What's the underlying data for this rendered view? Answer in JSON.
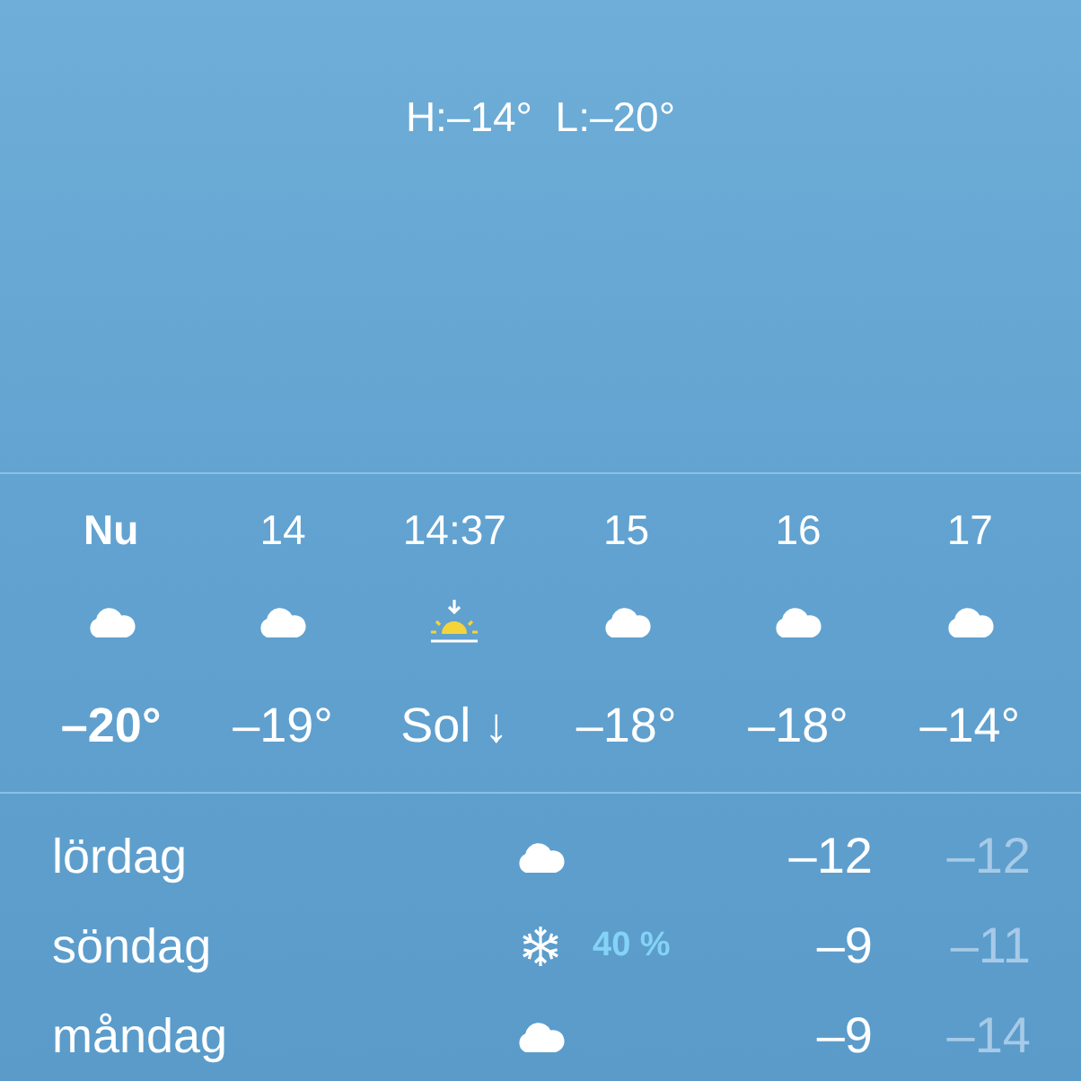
{
  "current": {
    "high_low": "H:–14°  L:–20°"
  },
  "hourly": [
    {
      "time": "Nu",
      "kind": "cloud",
      "temp": "–20°",
      "current": true
    },
    {
      "time": "14",
      "kind": "cloud",
      "temp": "–19°",
      "current": false
    },
    {
      "time": "14:37",
      "kind": "sunset",
      "temp": "Sol ↓",
      "current": false
    },
    {
      "time": "15",
      "kind": "cloud",
      "temp": "–18°",
      "current": false
    },
    {
      "time": "16",
      "kind": "cloud",
      "temp": "–18°",
      "current": false
    },
    {
      "time": "17",
      "kind": "cloud",
      "temp": "–14°",
      "current": false
    }
  ],
  "daily": [
    {
      "day": "lördag",
      "kind": "cloud",
      "high": "–12",
      "low": "–12"
    },
    {
      "day": "söndag",
      "kind": "snow",
      "precip": "40 %",
      "high": "–9",
      "low": "–11"
    },
    {
      "day": "måndag",
      "kind": "cloud",
      "high": "–9",
      "low": "–14"
    }
  ]
}
